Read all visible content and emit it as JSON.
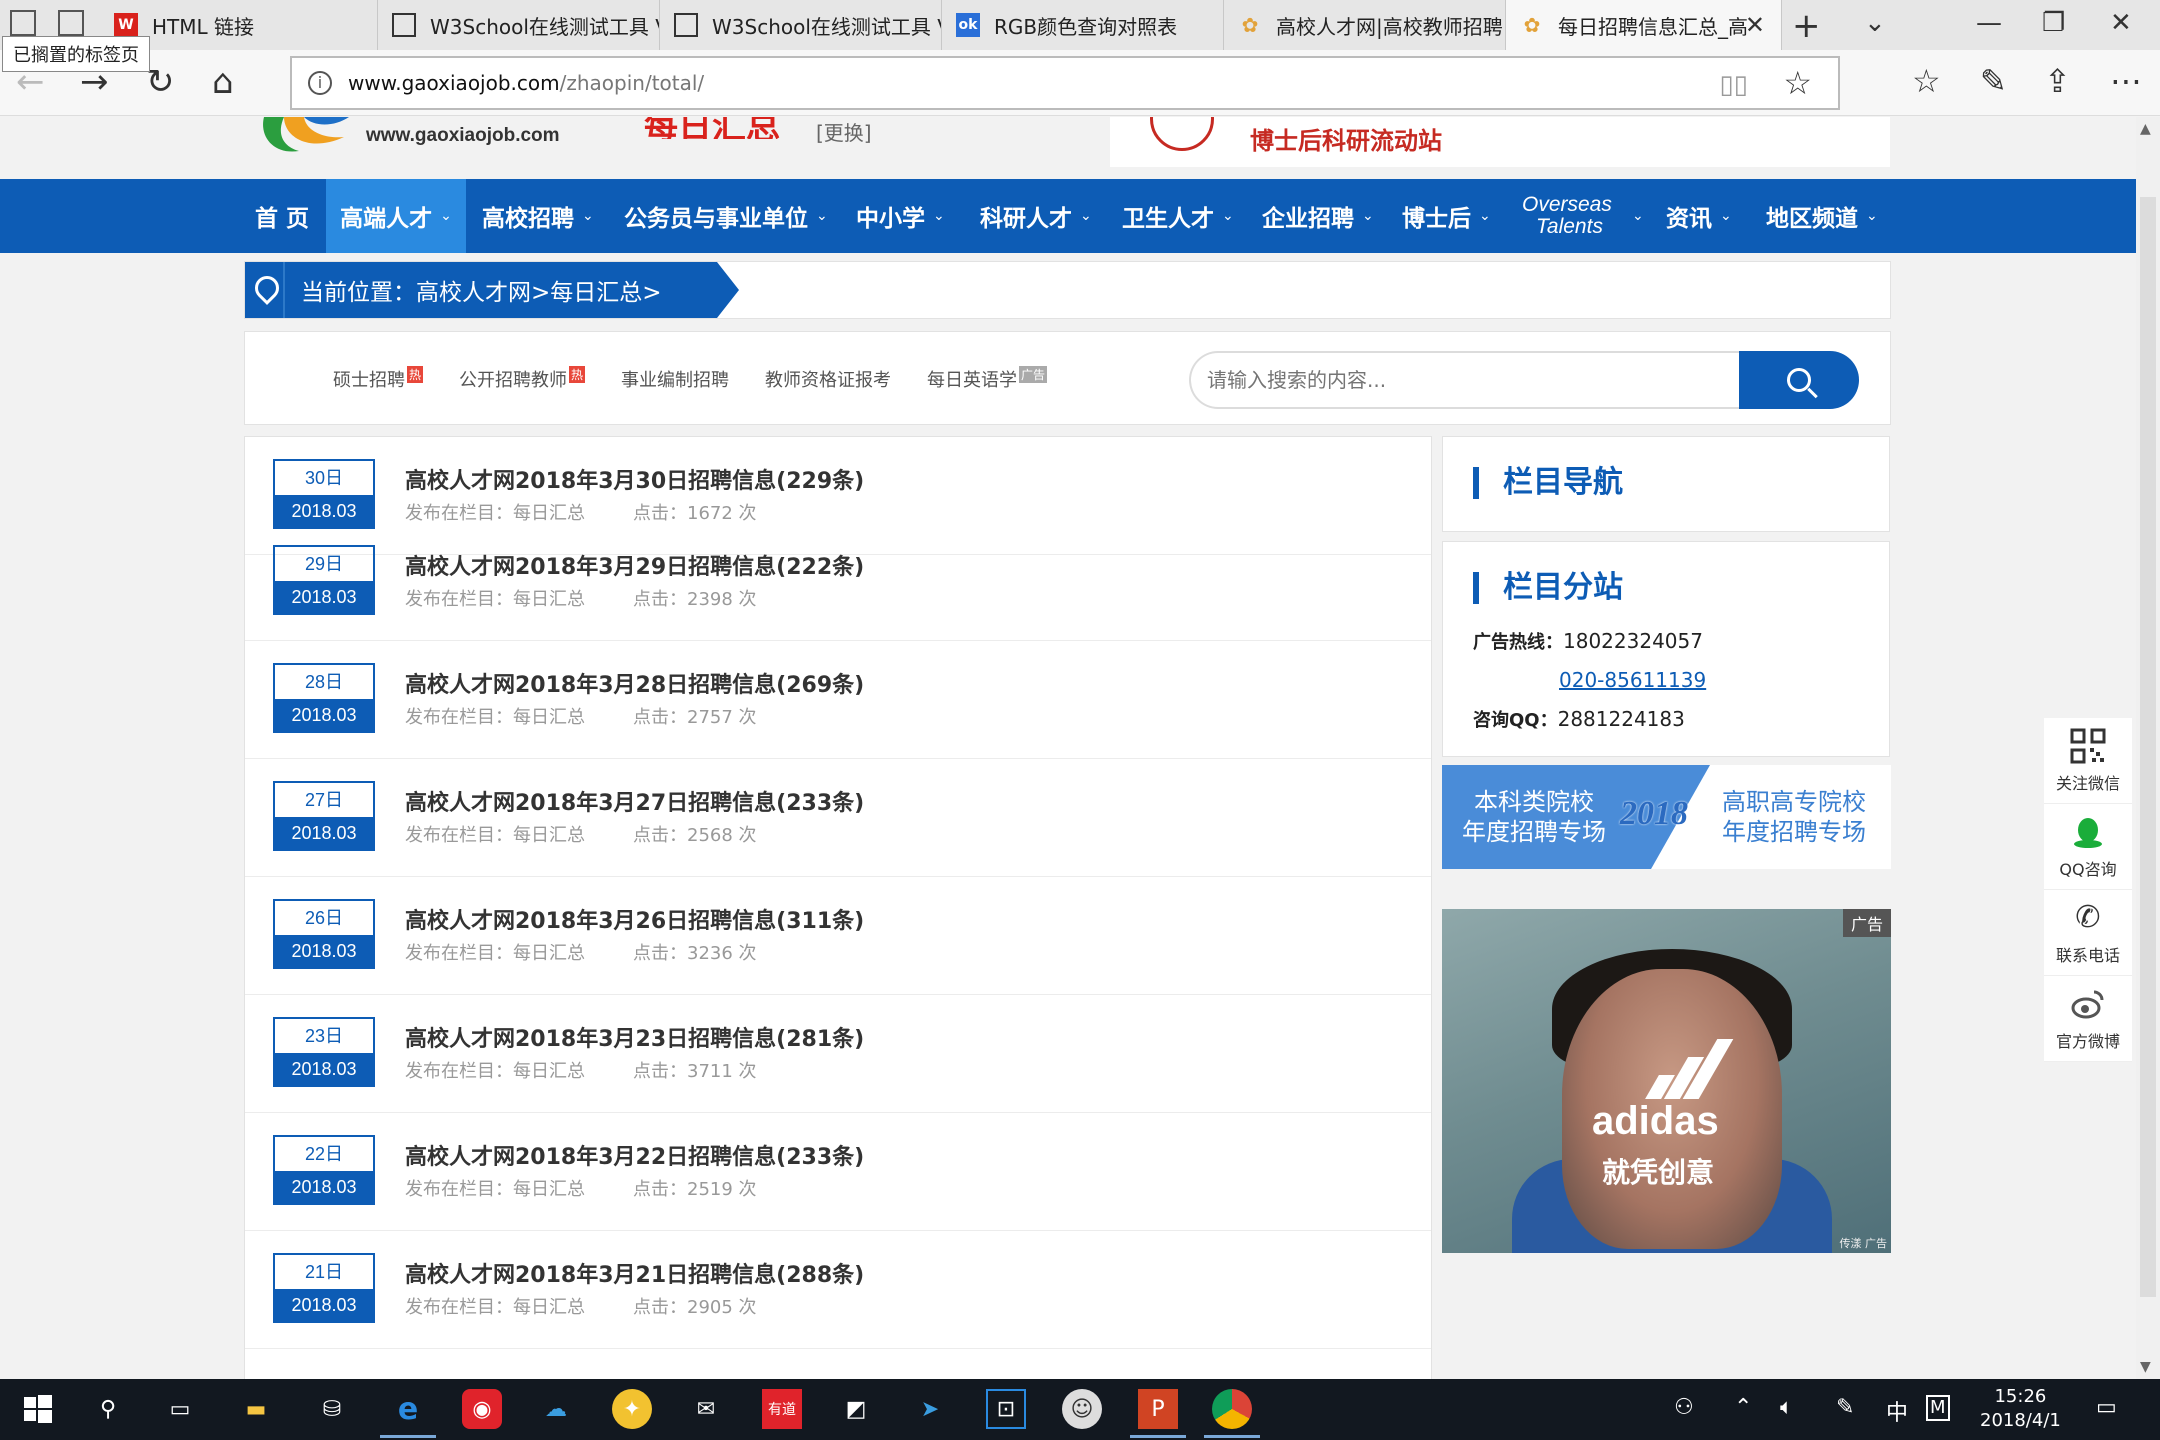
{
  "browser": {
    "tooltip": "已搁置的标签页",
    "tabs": [
      {
        "label": "HTML 链接",
        "favicon_color": "#d9221c",
        "favicon": "W"
      },
      {
        "label": "W3School在线测试工具 V",
        "favicon_color": "#333333",
        "favicon": "□"
      },
      {
        "label": "W3School在线测试工具 V",
        "favicon_color": "#333333",
        "favicon": "□"
      },
      {
        "label": "RGB颜色查询对照表",
        "favicon_color": "#2a6fd8",
        "favicon": "ok"
      },
      {
        "label": "高校人才网|高校教师招聘",
        "favicon_color": "#e2a23a",
        "favicon": "✿"
      },
      {
        "label": "每日招聘信息汇总_高",
        "favicon_color": "#e2a23a",
        "favicon": "✿"
      }
    ],
    "url_host": "www.gaoxiaojob.com",
    "url_path": "/zhaopin/total/"
  },
  "site": {
    "logo_url": "www.gaoxiaojob.com",
    "section_title": "每日汇总",
    "change_label": "[更换]",
    "ad_banner_text": "博士后科研流动站",
    "nav": [
      {
        "label": "首 页",
        "has_chevron": false
      },
      {
        "label": "高端人才",
        "has_chevron": true
      },
      {
        "label": "高校招聘",
        "has_chevron": true
      },
      {
        "label": "公务员与事业单位",
        "has_chevron": true
      },
      {
        "label": "中小学",
        "has_chevron": true
      },
      {
        "label": "科研人才",
        "has_chevron": true
      },
      {
        "label": "卫生人才",
        "has_chevron": true
      },
      {
        "label": "企业招聘",
        "has_chevron": true
      },
      {
        "label": "博士后",
        "has_chevron": true
      },
      {
        "label": "Overseas",
        "label2": "Talents",
        "has_chevron": true
      },
      {
        "label": "资讯",
        "has_chevron": true
      },
      {
        "label": "地区频道",
        "has_chevron": true
      }
    ],
    "active_nav": "高端人才",
    "breadcrumb": "当前位置：高校人才网>每日汇总>",
    "quick_links": [
      {
        "label": "硕士招聘",
        "badge": "热"
      },
      {
        "label": "公开招聘教师",
        "badge": "热"
      },
      {
        "label": "事业编制招聘",
        "badge": ""
      },
      {
        "label": "教师资格证报考",
        "badge": ""
      },
      {
        "label": "每日英语学",
        "badge": "广告"
      }
    ],
    "search_placeholder": "请输入搜索的内容..."
  },
  "list": {
    "meta_column_prefix": "发布在栏目：每日汇总",
    "clicks_prefix": "点击：",
    "clicks_suffix": " 次",
    "items": [
      {
        "day": "30日",
        "month": "2018.03",
        "title": "高校人才网2018年3月30日招聘信息(229条)",
        "clicks": "1672"
      },
      {
        "day": "29日",
        "month": "2018.03",
        "title": "高校人才网2018年3月29日招聘信息(222条)",
        "clicks": "2398"
      },
      {
        "day": "28日",
        "month": "2018.03",
        "title": "高校人才网2018年3月28日招聘信息(269条)",
        "clicks": "2757"
      },
      {
        "day": "27日",
        "month": "2018.03",
        "title": "高校人才网2018年3月27日招聘信息(233条)",
        "clicks": "2568"
      },
      {
        "day": "26日",
        "month": "2018.03",
        "title": "高校人才网2018年3月26日招聘信息(311条)",
        "clicks": "3236"
      },
      {
        "day": "23日",
        "month": "2018.03",
        "title": "高校人才网2018年3月23日招聘信息(281条)",
        "clicks": "3711"
      },
      {
        "day": "22日",
        "month": "2018.03",
        "title": "高校人才网2018年3月22日招聘信息(233条)",
        "clicks": "2519"
      },
      {
        "day": "21日",
        "month": "2018.03",
        "title": "高校人才网2018年3月21日招聘信息(288条)",
        "clicks": "2905"
      }
    ]
  },
  "sidebar": {
    "nav_title": "栏目导航",
    "branch_title": "栏目分站",
    "ad_hotline_label": "广告热线：",
    "ad_hotline_1": "18022324057",
    "ad_hotline_2": "020-85611139",
    "qq_label": "咨询QQ：",
    "qq_number": "2881224183",
    "promo_left": "本科类院校",
    "promo_left2": "年度招聘专场",
    "promo_year": "2018",
    "promo_right": "高职高专院校",
    "promo_right2": "年度招聘专场",
    "ad_brand": "adidas",
    "ad_slogan": "就凭创意",
    "ad_tag": "广告",
    "ad_tag_small": "传漾 广告"
  },
  "float_panel": [
    {
      "label": "关注微信",
      "icon": "qr-code-icon"
    },
    {
      "label": "QQ咨询",
      "icon": "qq-icon"
    },
    {
      "label": "联系电话",
      "icon": "phone-icon"
    },
    {
      "label": "官方微博",
      "icon": "weibo-icon"
    }
  ],
  "taskbar": {
    "time": "15:26",
    "date": "2018/4/1",
    "ime": "中",
    "ime2": "M"
  }
}
